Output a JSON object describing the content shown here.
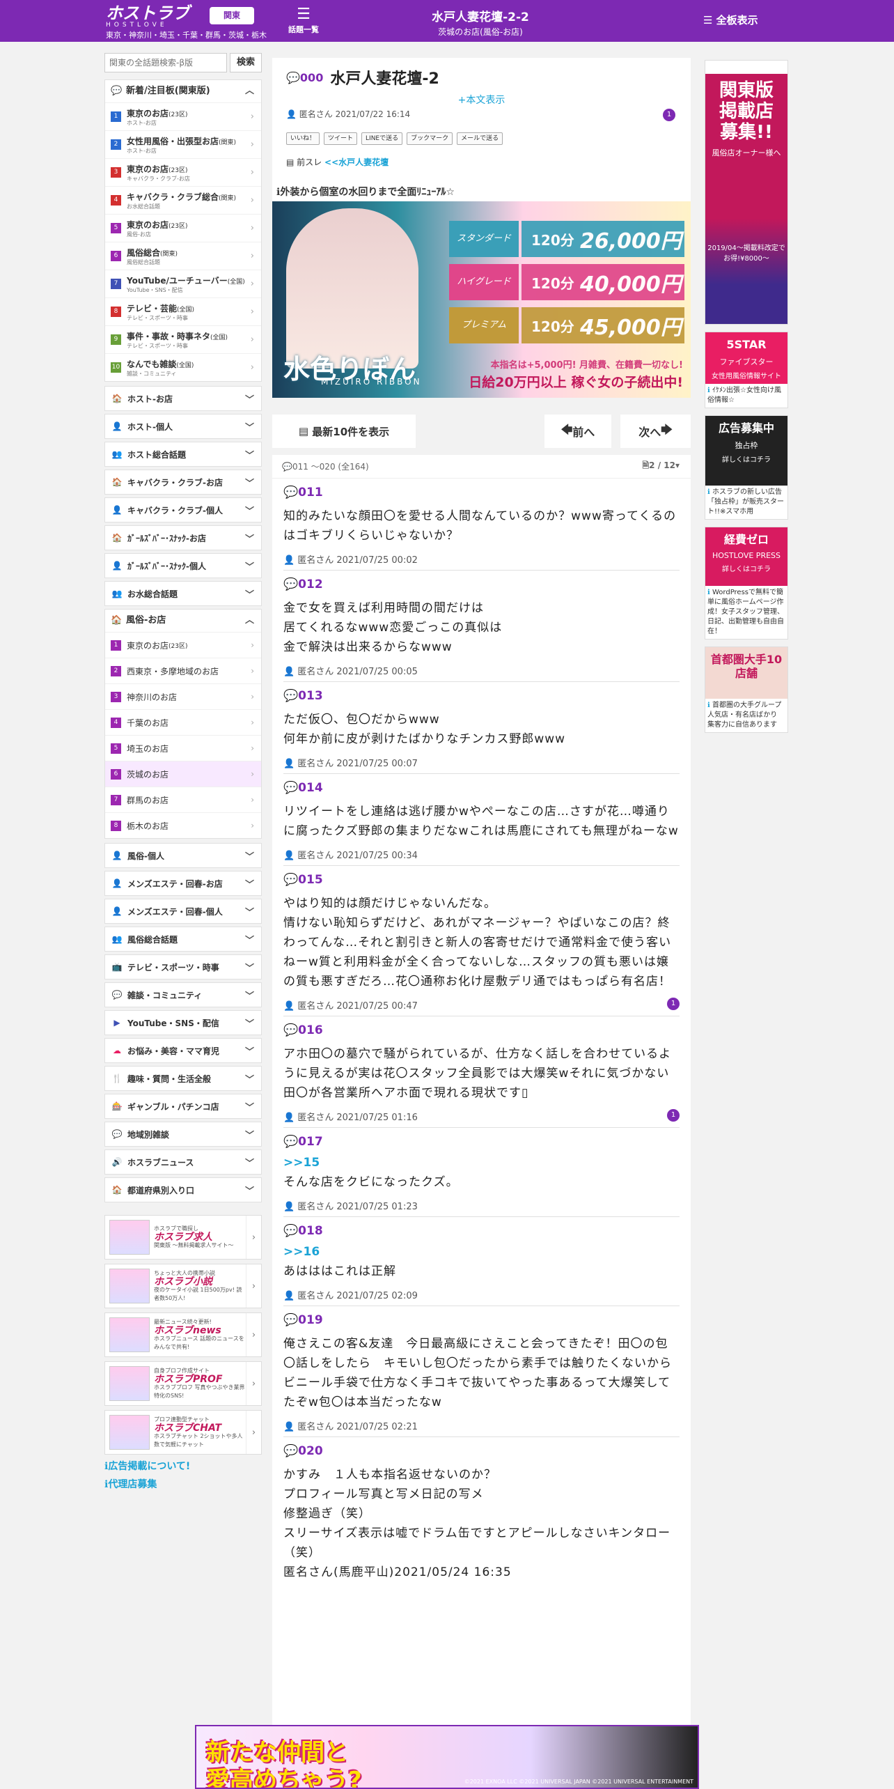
{
  "header": {
    "logo": "ホストラブ",
    "logo_sub": "HOSTLOVE",
    "region": "関東",
    "areas": "東京・神奈川・埼玉・千葉・群馬・茨城・栃木",
    "topics": "話題一覧",
    "title": "水戸人妻花壇-2-2",
    "subtitle": "茨城のお店(風俗-お店)",
    "board": "全板表示"
  },
  "sidebar": {
    "search_placeholder": "関東の全話題検索-β版",
    "search_button": "検索",
    "new_header": "新着/注目板(関東版)",
    "new_items": [
      {
        "num": "1",
        "color": "#2a6bd1",
        "label": "東京のお店",
        "suffix": "(23区)",
        "sub": "ホスト-お店"
      },
      {
        "num": "2",
        "color": "#2a6bd1",
        "label": "女性用風俗・出張型お店",
        "suffix": "(関東)",
        "sub": "ホスト-お店"
      },
      {
        "num": "3",
        "color": "#d32f2f",
        "label": "東京のお店",
        "suffix": "(23区)",
        "sub": "キャバクラ・クラブ-お店"
      },
      {
        "num": "4",
        "color": "#d32f2f",
        "label": "キャバクラ・クラブ総合",
        "suffix": "(関東)",
        "sub": "お水総合話題"
      },
      {
        "num": "5",
        "color": "#9c27b0",
        "label": "東京のお店",
        "suffix": "(23区)",
        "sub": "風俗-お店"
      },
      {
        "num": "6",
        "color": "#9c27b0",
        "label": "風俗総合",
        "suffix": "(関東)",
        "sub": "風俗総合話題"
      },
      {
        "num": "7",
        "color": "#3f51b5",
        "label": "YouTube/ユーチューバー",
        "suffix": "(全国)",
        "sub": "YouTube・SNS・配信"
      },
      {
        "num": "8",
        "color": "#d32f2f",
        "label": "テレビ・芸能",
        "suffix": "(全国)",
        "sub": "テレビ・スポーツ・時事"
      },
      {
        "num": "9",
        "color": "#689f38",
        "label": "事件・事故・時事ネタ",
        "suffix": "(全国)",
        "sub": "テレビ・スポーツ・時事"
      },
      {
        "num": "10",
        "color": "#689f38",
        "label": "なんでも雑談",
        "suffix": "(全国)",
        "sub": "雑談・コミュニティ"
      }
    ],
    "cats_top": [
      {
        "icon": "🏠",
        "color": "#1e88e5",
        "label": "ホスト-お店"
      },
      {
        "icon": "👤",
        "color": "#1e88e5",
        "label": "ホスト-個人"
      },
      {
        "icon": "👥",
        "color": "#1e88e5",
        "label": "ホスト総合話題"
      },
      {
        "icon": "🏠",
        "color": "#e53935",
        "label": "キャバクラ・クラブ-お店"
      },
      {
        "icon": "👤",
        "color": "#e53935",
        "label": "キャバクラ・クラブ-個人"
      },
      {
        "icon": "🏠",
        "color": "#e53935",
        "label": "ｶﾞｰﾙｽﾞﾊﾞｰ･ｽﾅｯｸ-お店"
      },
      {
        "icon": "👤",
        "color": "#e53935",
        "label": "ｶﾞｰﾙｽﾞﾊﾞｰ･ｽﾅｯｸ-個人"
      },
      {
        "icon": "👥",
        "color": "#e53935",
        "label": "お水総合話題"
      }
    ],
    "fuzoku_header": "風俗-お店",
    "fuzoku_items": [
      {
        "num": "1",
        "label": "東京のお店",
        "suffix": "(23区)"
      },
      {
        "num": "2",
        "label": "西東京・多摩地域のお店",
        "suffix": ""
      },
      {
        "num": "3",
        "label": "神奈川のお店",
        "suffix": ""
      },
      {
        "num": "4",
        "label": "千葉のお店",
        "suffix": ""
      },
      {
        "num": "5",
        "label": "埼玉のお店",
        "suffix": ""
      },
      {
        "num": "6",
        "label": "茨城のお店",
        "suffix": ""
      },
      {
        "num": "7",
        "label": "群馬のお店",
        "suffix": ""
      },
      {
        "num": "8",
        "label": "栃木のお店",
        "suffix": ""
      }
    ],
    "cats_bottom": [
      {
        "icon": "👤",
        "color": "#9c27b0",
        "label": "風俗-個人"
      },
      {
        "icon": "👤",
        "color": "#9c27b0",
        "label": "メンズエステ・回春-お店"
      },
      {
        "icon": "👤",
        "color": "#9c27b0",
        "label": "メンズエステ・回春-個人"
      },
      {
        "icon": "👥",
        "color": "#9c27b0",
        "label": "風俗総合話題"
      },
      {
        "icon": "📺",
        "color": "#689f38",
        "label": "テレビ・スポーツ・時事"
      },
      {
        "icon": "💬",
        "color": "#689f38",
        "label": "雑談・コミュニティ"
      },
      {
        "icon": "▶",
        "color": "#3f51b5",
        "label": "YouTube・SNS・配信"
      },
      {
        "icon": "☁",
        "color": "#e91e63",
        "label": "お悩み・美容・ママ育児"
      },
      {
        "icon": "🍴",
        "color": "#e53935",
        "label": "趣味・質問・生活全般"
      },
      {
        "icon": "🎰",
        "color": "#e53935",
        "label": "ギャンブル・パチンコ店"
      },
      {
        "icon": "💬",
        "color": "#1e88e5",
        "label": "地域別雑談"
      },
      {
        "icon": "🔊",
        "color": "#555555",
        "label": "ホスラブニュース"
      },
      {
        "icon": "🏠",
        "color": "#1e88e5",
        "label": "都道府県別入り口"
      }
    ],
    "promos": [
      {
        "small": "ホスラブで職探し",
        "title": "ホスラブ求人",
        "desc": "関東版 〜無料掲載求人サイト〜"
      },
      {
        "small": "ちょっと大人の携帯小説",
        "title": "ホスラブ小説",
        "desc": "夜のケータイ小説 1日500万pv! 読者数50万人!"
      },
      {
        "small": "最新ニュース続々更新!",
        "title": "ホスラブnews",
        "desc": "ホスラブニュース 話題のニュースをみんなで共有!"
      },
      {
        "small": "自身プロフ作成サイト",
        "title": "ホスラブPROF",
        "desc": "ホスラブプロフ 写真やつぶやき業界特化のSNS!"
      },
      {
        "small": "プロフ連動型チャット",
        "title": "ホスラブCHAT",
        "desc": "ホスラブチャット 2ショットや多人数で気軽にチャット"
      }
    ],
    "link_ad": "広告掲載について!",
    "link_agency": "代理店募集"
  },
  "thread": {
    "num": "000",
    "title": "水戸人妻花壇-2",
    "show_body": "+本文表示",
    "author": "匿名さん",
    "date": "2021/07/22 16:14",
    "badge": "1",
    "share": [
      "いいね！",
      "ツイート",
      "LINEで送る",
      "ブックマーク",
      "メールで送る"
    ],
    "prev_label": "前スレ",
    "prev_link": "<<水戸人妻花壇"
  },
  "ad": {
    "title": "外装から個室の水回りまで全面ﾘﾆｭｰｱﾙ☆",
    "brand": "水色りぼん",
    "brand_sub": "MIZUIRO RIBBON",
    "catch1": "本指名は+5,000円! 月雑費、在籍費一切なし!",
    "catch2": "日給20万円以上 稼ぐ女の子続出中!",
    "prices": [
      {
        "label": "スタンダード",
        "min": "120分",
        "yen": "26,000円",
        "color": "#3a9fb8"
      },
      {
        "label": "ハイグレード",
        "min": "120分",
        "yen": "40,000円",
        "color": "#e0468a"
      },
      {
        "label": "プレミアム",
        "min": "120分",
        "yen": "45,000円",
        "color": "#c19a3a"
      }
    ]
  },
  "pager": {
    "latest": "最新10件を表示",
    "prev": "前へ",
    "next": "次へ",
    "range": "011 ～020 (全164)",
    "page": "2 / 12"
  },
  "posts": [
    {
      "num": "011",
      "body": "知的みたいな顔田〇を愛せる人間なんているのか？www寄ってくるのはゴキブリくらいじゃないか？",
      "author": "匿名さん",
      "date": "2021/07/25 00:02",
      "badge": ""
    },
    {
      "num": "012",
      "body": "金で女を買えば利用時間の間だけは\n居てくれるなwww恋愛ごっこの真似は\n金で解決は出来るからなwww",
      "author": "匿名さん",
      "date": "2021/07/25 00:05",
      "badge": ""
    },
    {
      "num": "013",
      "body": "ただ仮〇、包〇だからwww\n何年か前に皮が剥けたばかりなチンカス野郎www",
      "author": "匿名さん",
      "date": "2021/07/25 00:07",
      "badge": ""
    },
    {
      "num": "014",
      "body": "リツイートをし連絡は逃げ腰かwやぺーなこの店…さすが花…噂通りに腐ったクズ野郎の集まりだなwこれは馬鹿にされても無理がねーなw",
      "author": "匿名さん",
      "date": "2021/07/25 00:34",
      "badge": ""
    },
    {
      "num": "015",
      "body": "やはり知的は顔だけじゃないんだな。\n情けない恥知らずだけど、あれがマネージャー？やばいなこの店？終わってんな…それと割引きと新人の客寄せだけで通常料金で使う客いねーw質と利用料金が全く合ってないしな…スタッフの質も悪いは嬢の質も悪すぎだろ…花〇通称お化け屋敷デリ通ではもっぱら有名店！",
      "author": "匿名さん",
      "date": "2021/07/25 00:47",
      "badge": "1"
    },
    {
      "num": "016",
      "body": "アホ田〇の墓穴で騒がられているが、仕方なく話しを合わせているように見えるが実は花〇スタッフ全員影では大爆笑wそれに気づかない田〇が各営業所へアホ面で現れる現状です▯",
      "author": "匿名さん",
      "date": "2021/07/25 01:16",
      "badge": "1"
    },
    {
      "num": "017",
      "anchor": ">>15",
      "body": "そんな店をクビになったクズ。",
      "author": "匿名さん",
      "date": "2021/07/25 01:23",
      "badge": ""
    },
    {
      "num": "018",
      "anchor": ">>16",
      "body": "あはははこれは正解",
      "author": "匿名さん",
      "date": "2021/07/25 02:09",
      "badge": ""
    },
    {
      "num": "019",
      "body": "俺さえこの客&友達　今日最高級にさえこと会ってきたぞ！田〇の包〇話しをしたら　キモいし包〇だったから素手では触りたくないからビニール手袋で仕方なく手コキで抜いてやった事あるって大爆笑してたぞw包〇は本当だったなw",
      "author": "匿名さん",
      "date": "2021/07/25 02:21",
      "badge": ""
    },
    {
      "num": "020",
      "body": "かすみ　１人も本指名返せないのか？\nプロフィール写真と写メ日記の写メ\n修整過ぎ（笑）\nスリーサイズ表示は嘘でドラム缶ですとアピールしなさいキンタロー（笑）\n匿名さん(馬鹿平山)2021/05/24 16:35",
      "author": "",
      "date": "",
      "badge": ""
    }
  ],
  "right_ads": [
    {
      "headline": "関東版掲載店募集!!",
      "sub": "風俗店オーナー様へ",
      "note": "2019/04〜掲載料改定でお得!¥8000〜",
      "caption": "",
      "bg": "#c2185b"
    },
    {
      "headline": "5STAR",
      "sub": "ファイブスター",
      "note": "女性用風俗情報サイト",
      "caption": "ｲｹﾒﾝ出張☆女性向け風俗情報☆",
      "bg": "#e91e63"
    },
    {
      "headline": "広告募集中",
      "sub": "独占枠",
      "note": "詳しくはコチラ",
      "caption": "ホスラブの新しい広告「独占枠」が販売スタート!!※スマホ用",
      "bg": "#222222"
    },
    {
      "headline": "経費ゼロ",
      "sub": "HOSTLOVE PRESS",
      "note": "詳しくはコチラ",
      "caption": "WordPressで無料で簡単に風俗ホームページ作成！女子スタッフ管理、日記、出勤管理も自由自在！",
      "bg": "#d81b60"
    },
    {
      "headline": "首都圏大手10店舗",
      "sub": "",
      "note": "",
      "caption": "首都圏の大手グループ人気店・有名店ばかり 集客力に自信あります",
      "bg": "#f3d9d2"
    }
  ],
  "bottom_ad": {
    "line1": "新たな仲間と",
    "line2": "愛高めちゃう?",
    "copy": "©2021 EXNOA LLC ©2021 UNIVERSAL JAPAN ©2021 UNIVERSAL ENTERTAINMENT"
  }
}
